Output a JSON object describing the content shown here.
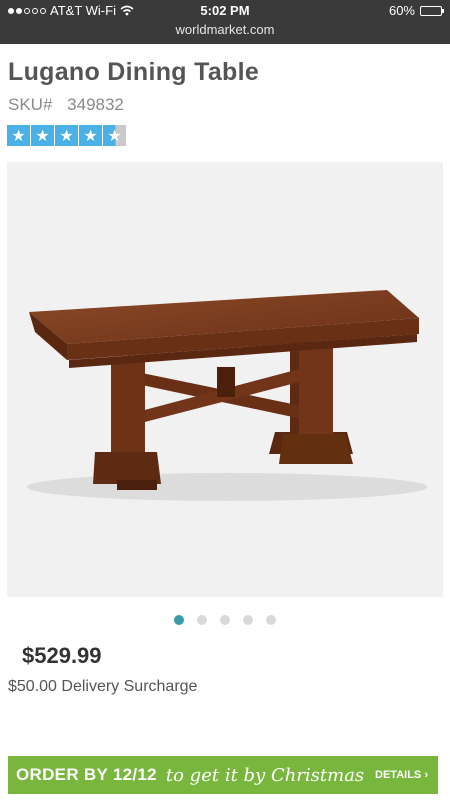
{
  "status_bar": {
    "carrier": "AT&T Wi-Fi",
    "time": "5:02 PM",
    "battery": "60%",
    "battery_level": 0.6,
    "url": "worldmarket.com",
    "signal_bars_filled": 2,
    "signal_bars_total": 5
  },
  "product": {
    "title": "Lugano Dining Table",
    "sku_label": "SKU#",
    "sku_value": "349832",
    "rating": 4.5,
    "rating_max": 5,
    "price": "$529.99",
    "delivery_surcharge": "$50.00 Delivery Surcharge"
  },
  "gallery": {
    "image_alt": "Lugano Dining Table",
    "total_slides": 5,
    "active_slide": 1
  },
  "promo": {
    "text_main": "ORDER BY 12/12",
    "text_script": "to get it by Christmas",
    "details": "DETAILS ›"
  },
  "colors": {
    "status_bar_bg": "#3a3a3a",
    "star_blue": "#49b1e6",
    "active_dot": "#3a9aa5",
    "promo_green": "#78b63e",
    "wood": "#7a3a1d"
  }
}
